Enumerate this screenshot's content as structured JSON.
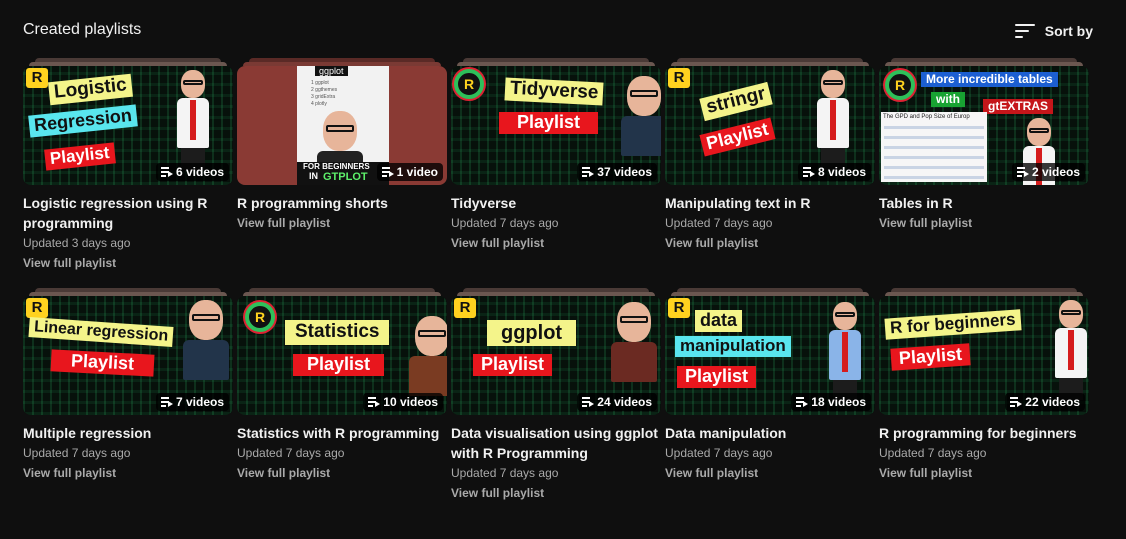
{
  "header": {
    "title": "Created playlists",
    "sort_label": "Sort by"
  },
  "playlists": [
    {
      "title": "Logistic regression using R programming",
      "updated": "Updated 3 days ago",
      "view_label": "View full playlist",
      "count": "6 videos",
      "thumb_text": [
        "Logistic",
        "Regression",
        "Playlist"
      ],
      "logo": "R"
    },
    {
      "title": "R programming shorts",
      "updated": "",
      "view_label": "View full playlist",
      "count": "1 video",
      "thumb_text": [
        "ggplot",
        "FOR BEGINNERS",
        "IN",
        "GTPLOT"
      ],
      "board_lines": [
        "1 ggplot",
        "2 ggthemes",
        "3 gridExtra",
        "4 plotly"
      ]
    },
    {
      "title": "Tidyverse",
      "updated": "Updated 7 days ago",
      "view_label": "View full playlist",
      "count": "37 videos",
      "thumb_text": [
        "Tidyverse",
        "Playlist"
      ],
      "logo": "R"
    },
    {
      "title": "Manipulating text in R",
      "updated": "Updated 7 days ago",
      "view_label": "View full playlist",
      "count": "8 videos",
      "thumb_text": [
        "stringr",
        "Playlist"
      ],
      "logo": "R"
    },
    {
      "title": "Tables in R",
      "updated": "",
      "view_label": "View full playlist",
      "count": "2 videos",
      "thumb_text": [
        "More incredible tables",
        "with",
        "gtEXTRAS",
        "The GPD and Pop Size of Europ"
      ],
      "logo": "R"
    },
    {
      "title": "Multiple regression",
      "updated": "Updated 7 days ago",
      "view_label": "View full playlist",
      "count": "7 videos",
      "thumb_text": [
        "Linear regression",
        "Playlist"
      ],
      "logo": "R"
    },
    {
      "title": "Statistics with R programming",
      "updated": "Updated 7 days ago",
      "view_label": "View full playlist",
      "count": "10 videos",
      "thumb_text": [
        "Statistics",
        "Playlist"
      ],
      "logo": "R"
    },
    {
      "title": "Data visualisation using ggplot with R Programming",
      "updated": "Updated 7 days ago",
      "view_label": "View full playlist",
      "count": "24 videos",
      "thumb_text": [
        "ggplot",
        "Playlist"
      ],
      "logo": "R"
    },
    {
      "title": "Data manipulation",
      "updated": "Updated 7 days ago",
      "view_label": "View full playlist",
      "count": "18 videos",
      "thumb_text": [
        "data",
        "manipulation",
        "Playlist"
      ],
      "logo": "R"
    },
    {
      "title": "R programming for beginners",
      "updated": "Updated 7 days ago",
      "view_label": "View full playlist",
      "count": "22 videos",
      "thumb_text": [
        "R for beginners",
        "Playlist"
      ],
      "logo": "R"
    }
  ]
}
